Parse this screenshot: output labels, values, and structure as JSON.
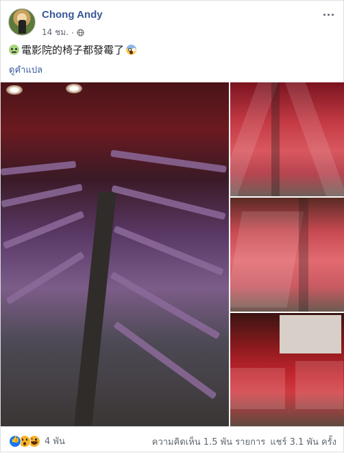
{
  "post": {
    "author": "Chong Andy",
    "time": "14 ชม.",
    "caption": "電影院的椅子都發霉了",
    "caption_emoji_start": "nauseated-face-icon",
    "caption_emoji_end": "face-screaming-icon",
    "translate_label": "ดูคำแปล"
  },
  "photos": [
    {
      "name": "moldy-purple-cinema-seats-photo"
    },
    {
      "name": "moldy-red-seats-aisle-photo"
    },
    {
      "name": "red-seats-rows-photo"
    },
    {
      "name": "theater-screen-red-seats-photo"
    }
  ],
  "stats": {
    "reactions": [
      "like",
      "wow",
      "haha"
    ],
    "reaction_count": "4 พัน",
    "comments": "ความคิดเห็น 1.5 พัน รายการ",
    "shares": "แชร์ 3.1 พัน ครั้ง"
  },
  "colors": {
    "link": "#385898",
    "meta": "#616770",
    "like": "#1877f2"
  }
}
